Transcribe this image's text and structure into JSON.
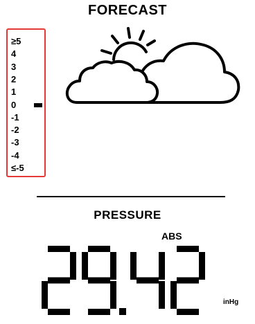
{
  "forecast": {
    "title": "FORECAST",
    "condition_icon": "partly-cloudy-icon",
    "scale": [
      "≥5",
      "4",
      "3",
      "2",
      "1",
      "0",
      "-1",
      "-2",
      "-3",
      "-4",
      "≤-5"
    ],
    "current_level": "0",
    "scale_border_color": "#e53935"
  },
  "pressure": {
    "title": "PRESSURE",
    "mode": "ABS",
    "value": "29.42",
    "unit": "inHg"
  }
}
